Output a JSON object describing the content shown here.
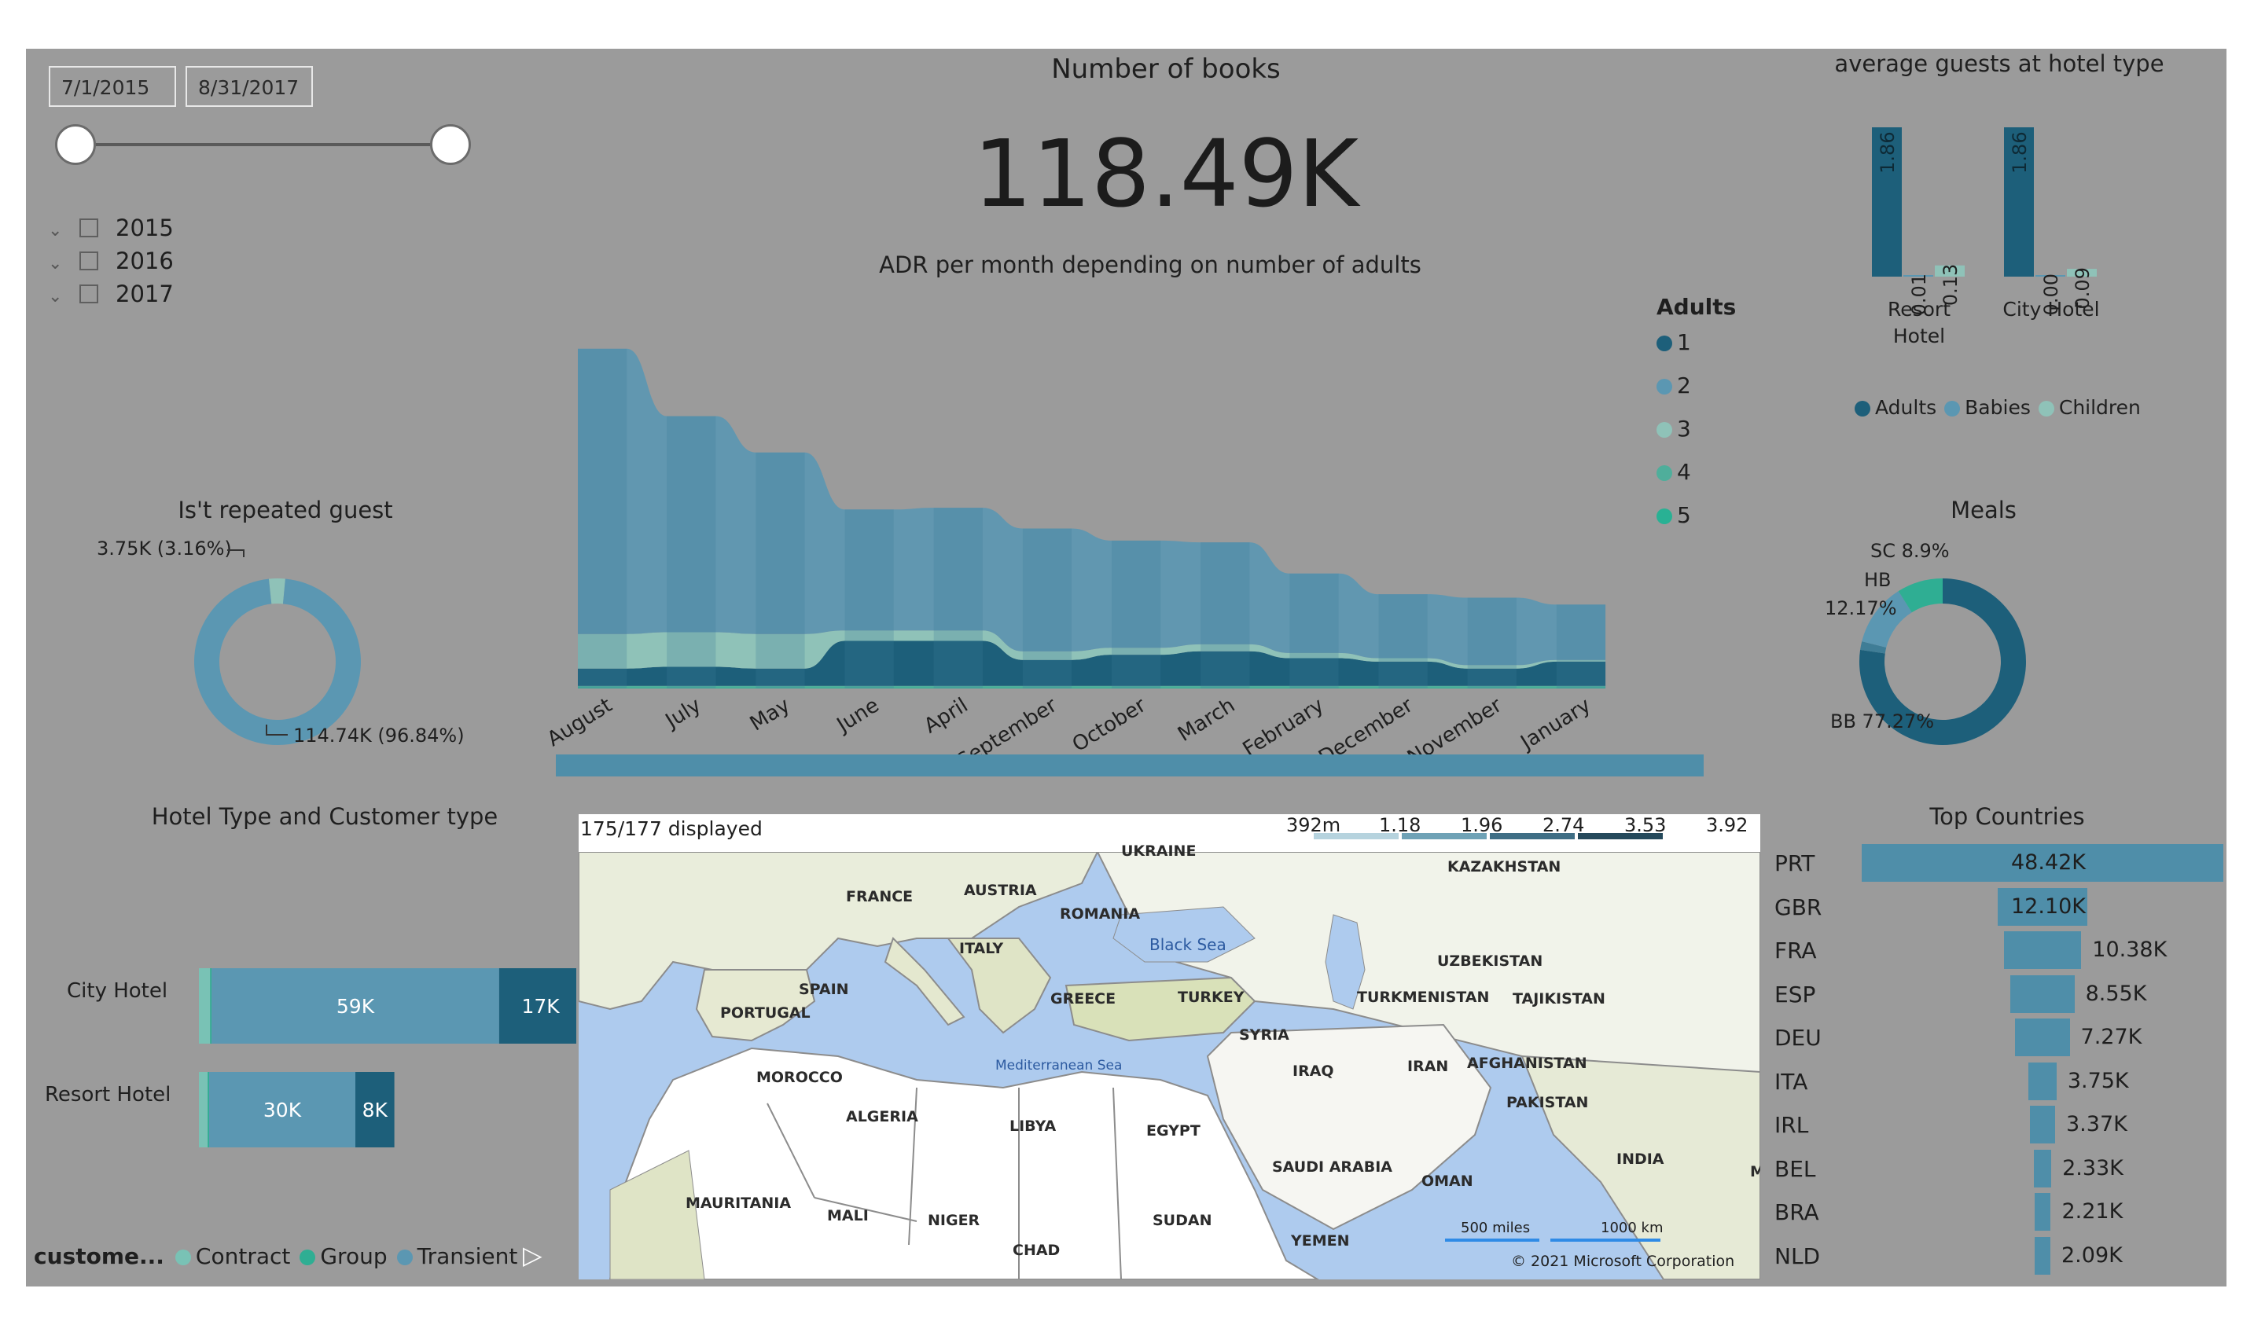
{
  "filters": {
    "start_date": "7/1/2015",
    "end_date": "8/31/2017",
    "years": [
      "2015",
      "2016",
      "2017"
    ]
  },
  "kpi": {
    "title": "Number of books",
    "value": "118.49K"
  },
  "adr_chart": {
    "title": "ADR per month depending on number of adults",
    "legend_title": "Adults",
    "legend": [
      {
        "name": "1",
        "color": "#1d5f7a"
      },
      {
        "name": "2",
        "color": "#5b97b2"
      },
      {
        "name": "3",
        "color": "#8fc2b8"
      },
      {
        "name": "4",
        "color": "#4fae9b"
      },
      {
        "name": "5",
        "color": "#29b194"
      }
    ]
  },
  "avg_guests": {
    "title": "average guests at hotel type",
    "legend": [
      {
        "name": "Adults",
        "color": "#1d5f7a"
      },
      {
        "name": "Babies",
        "color": "#5b97b2"
      },
      {
        "name": "Children",
        "color": "#8fc2b8"
      }
    ]
  },
  "repeated_guest": {
    "title": "Is't repeated guest",
    "label_small": "3.75K (3.16%)",
    "label_large": "114.74K (96.84%)"
  },
  "meals": {
    "title": "Meals",
    "label_sc": "SC 8.9%",
    "label_hb_1": "HB",
    "label_hb_2": "12.17%",
    "label_bb": "BB 77.27%"
  },
  "hotel_customer": {
    "title": "Hotel Type and Customer type",
    "legend_title": "custome...",
    "legend": [
      {
        "name": "Contract",
        "color": "#79c2b5"
      },
      {
        "name": "Group",
        "color": "#2fae93"
      },
      {
        "name": "Transient",
        "color": "#5b97b2"
      }
    ]
  },
  "map": {
    "displayed": "175/177 displayed",
    "scale_labels": [
      "392m",
      "1.18",
      "1.96",
      "2.74",
      "3.53",
      "3.92"
    ],
    "copyright": "© 2021 Microsoft Corporation",
    "scale_miles": "500 miles",
    "scale_km": "1000 km",
    "labels": {
      "ukraine": "UKRAINE",
      "kazakhstan": "KAZAKHSTAN",
      "france": "FRANCE",
      "austria": "AUSTRIA",
      "romania": "ROMANIA",
      "black_sea": "Black Sea",
      "italy": "ITALY",
      "uzbekistan": "UZBEKISTAN",
      "spain": "SPAIN",
      "portugal": "PORTUGAL",
      "greece": "GREECE",
      "turkey": "TURKEY",
      "turkmenistan": "TURKMENISTAN",
      "tajikistan": "TAJIKISTAN",
      "morocco": "MOROCCO",
      "mediterranean": "Mediterranean Sea",
      "syria": "SYRIA",
      "iraq": "IRAQ",
      "iran": "IRAN",
      "afghanistan": "AFGHANISTAN",
      "algeria": "ALGERIA",
      "libya": "LIBYA",
      "egypt": "EGYPT",
      "pakistan": "PAKISTAN",
      "saudi": "SAUDI ARABIA",
      "oman": "OMAN",
      "india": "INDIA",
      "mauritania": "MAURITANIA",
      "mali": "MALI",
      "niger": "NIGER",
      "sudan": "SUDAN",
      "chad": "CHAD",
      "yemen": "YEMEN",
      "m": "M"
    }
  },
  "top_countries": {
    "title": "Top Countries"
  },
  "chart_data": [
    {
      "type": "area",
      "title": "ADR per month depending on number of adults",
      "categories": [
        "August",
        "July",
        "May",
        "June",
        "April",
        "September",
        "October",
        "March",
        "February",
        "December",
        "November",
        "January"
      ],
      "series": [
        {
          "name": "1",
          "values": [
            1.0,
            1.1,
            1.0,
            2.6,
            2.6,
            1.5,
            1.8,
            2.0,
            1.6,
            1.4,
            1.0,
            1.4
          ]
        },
        {
          "name": "2",
          "values": [
            16.5,
            12.5,
            10.5,
            7.0,
            7.1,
            7.1,
            6.2,
            5.9,
            4.6,
            3.7,
            3.9,
            3.2
          ]
        },
        {
          "name": "3",
          "values": [
            2.0,
            2.0,
            2.0,
            0.6,
            0.6,
            0.5,
            0.4,
            0.4,
            0.3,
            0.2,
            0.2,
            0.1
          ]
        },
        {
          "name": "4",
          "values": [
            0.1,
            0.1,
            0.1,
            0.1,
            0.1,
            0.1,
            0.1,
            0.1,
            0.1,
            0.1,
            0.1,
            0.1
          ]
        },
        {
          "name": "5",
          "values": [
            0.05,
            0.05,
            0.05,
            0.05,
            0.05,
            0.05,
            0.05,
            0.05,
            0.05,
            0.05,
            0.05,
            0.05
          ]
        }
      ]
    },
    {
      "type": "bar",
      "title": "average guests at hotel type",
      "categories": [
        "Resort Hotel",
        "City Hotel"
      ],
      "series": [
        {
          "name": "Adults",
          "values": [
            1.86,
            1.86
          ]
        },
        {
          "name": "Babies",
          "values": [
            0.01,
            0.0
          ]
        },
        {
          "name": "Children",
          "values": [
            0.13,
            0.09
          ]
        }
      ],
      "value_labels": [
        [
          "1.86",
          "0.01",
          "0.13"
        ],
        [
          "1.86",
          "0.00",
          "0.09"
        ]
      ]
    },
    {
      "type": "pie",
      "title": "Is't repeated guest",
      "values": [
        3.16,
        96.84
      ],
      "labels": [
        "3.75K (3.16%)",
        "114.74K (96.84%)"
      ]
    },
    {
      "type": "pie",
      "title": "Meals",
      "categories": [
        "BB",
        "HB",
        "SC"
      ],
      "values": [
        77.27,
        12.17,
        8.9
      ]
    },
    {
      "type": "bar",
      "title": "Hotel Type and Customer type",
      "categories": [
        "City Hotel",
        "Resort Hotel"
      ],
      "series": [
        {
          "name": "Contract",
          "values": [
            2.3,
            1.8
          ]
        },
        {
          "name": "Group",
          "values": [
            0.3,
            0.3
          ]
        },
        {
          "name": "Transient",
          "values": [
            59,
            30
          ]
        },
        {
          "name": "",
          "values": [
            17,
            8
          ]
        }
      ],
      "value_labels": [
        [
          "59K",
          "17K"
        ],
        [
          "30K",
          "8K"
        ]
      ]
    },
    {
      "type": "bar",
      "title": "Top Countries",
      "categories": [
        "PRT",
        "GBR",
        "FRA",
        "ESP",
        "DEU",
        "ITA",
        "IRL",
        "BEL",
        "BRA",
        "NLD"
      ],
      "values": [
        48.42,
        12.1,
        10.38,
        8.55,
        7.27,
        3.75,
        3.37,
        2.33,
        2.21,
        2.09
      ],
      "value_labels": [
        "48.42K",
        "12.10K",
        "10.38K",
        "8.55K",
        "7.27K",
        "3.75K",
        "3.37K",
        "2.33K",
        "2.21K",
        "2.09K"
      ]
    }
  ]
}
